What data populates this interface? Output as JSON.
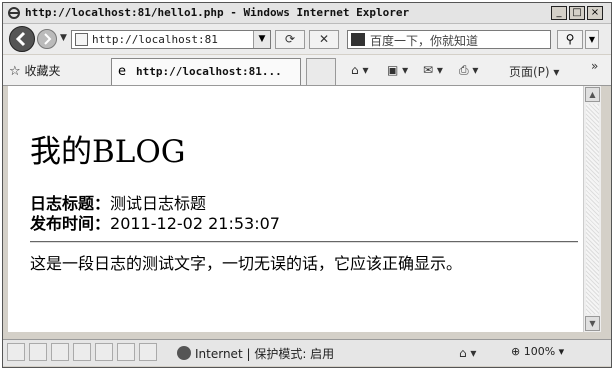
{
  "window": {
    "title": "http://localhost:81/hello1.php - Windows Internet Explorer",
    "controls": {
      "minimize": "_",
      "maximize": "□",
      "close": "×"
    }
  },
  "address_bar": {
    "url": "http://localhost:81",
    "search_placeholder": "百度一下，你就知道"
  },
  "favorites": {
    "label": "收藏夹"
  },
  "tab": {
    "label": "http://localhost:81..."
  },
  "command_bar": {
    "page_menu": "页面(P)"
  },
  "page": {
    "heading": "我的BLOG",
    "title_label": "日志标题：",
    "title_value": "测试日志标题",
    "date_label": "发布时间：",
    "date_value": "2011-12-02 21:53:07",
    "body": "这是一段日志的测试文字，一切无误的话，它应该正确显示。"
  },
  "status_bar": {
    "zone": "Internet",
    "protected_mode": "保护模式: 启用",
    "zoom": "100%"
  },
  "icons": [
    "ie-logo-icon",
    "back-icon",
    "forward-icon",
    "page-icon",
    "refresh-icon",
    "stop-icon",
    "baidu-icon",
    "search-icon",
    "star-icon",
    "home-icon",
    "feeds-icon",
    "mail-icon",
    "print-icon",
    "globe-icon"
  ]
}
